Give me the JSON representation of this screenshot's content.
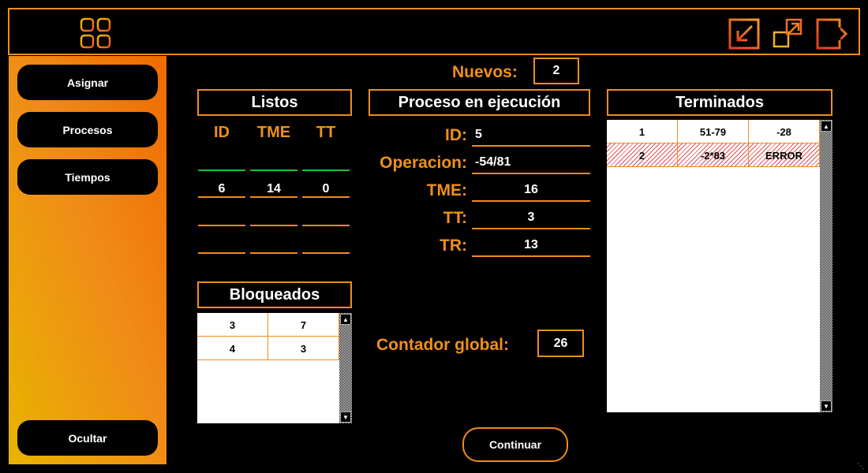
{
  "sidebar": {
    "items": [
      {
        "label": "Asignar"
      },
      {
        "label": "Procesos"
      },
      {
        "label": "Tiempos"
      }
    ],
    "hide_label": "Ocultar"
  },
  "new_processes": {
    "label": "Nuevos:",
    "value": "2"
  },
  "ready": {
    "title": "Listos",
    "columns": [
      "ID",
      "TME",
      "TT"
    ],
    "rows": [
      [
        "",
        "",
        ""
      ],
      [
        "6",
        "14",
        "0"
      ],
      [
        "",
        "",
        ""
      ],
      [
        "",
        "",
        ""
      ]
    ]
  },
  "running": {
    "title": "Proceso en ejecución",
    "fields": [
      {
        "label": "ID:",
        "value": "5"
      },
      {
        "label": "Operacion:",
        "value": "-54/81"
      },
      {
        "label": "TME:",
        "value": "16"
      },
      {
        "label": "TT:",
        "value": "3"
      },
      {
        "label": "TR:",
        "value": "13"
      }
    ]
  },
  "blocked": {
    "title": "Bloqueados",
    "rows": [
      [
        "3",
        "7"
      ],
      [
        "4",
        "3"
      ]
    ]
  },
  "finished": {
    "title": "Terminados",
    "rows": [
      [
        "1",
        "51-79",
        "-28"
      ],
      [
        "2",
        "-2*83",
        "ERROR"
      ]
    ]
  },
  "global_counter": {
    "label": "Contador global:",
    "value": "26"
  },
  "continue_label": "Continuar",
  "colors": {
    "accent": "#f08c20",
    "text_accent": "#f0901c",
    "ready_line": "#22c03c",
    "error_hatch": "#e05050"
  },
  "icons": {
    "app": "grid-icon",
    "minimize": "minimize-icon",
    "maximize": "maximize-icon",
    "exit": "exit-icon"
  }
}
